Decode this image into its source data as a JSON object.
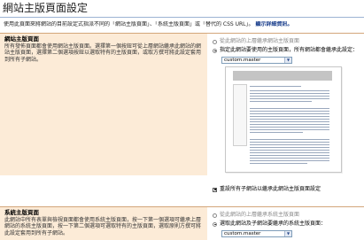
{
  "page": {
    "title": "網站主版頁面設定",
    "description_prefix": "使用此頁面來將網站的目前設定式指派不同的「網站主版頁面」、「系統主版頁面」或「替代的 CSS URL」。",
    "description_link": "顯示詳細資訊。"
  },
  "site_master": {
    "heading": "網站主版頁面",
    "help_text": "所有發佈頁面都會使用網站主版頁面。選擇第一個按鈕可從上層網站繼承此網站的網站主版頁面，選擇第二個選項按鈕以選取特有的主版頁面，或取方撰可將此設定套用到所有子網站。",
    "inherit_option": "從此網站的上層繼承網站主版頁面",
    "specify_option": "指定此網站要使用的主版頁面，所有網站都會繼承此設定：",
    "selected_master": "custom.master",
    "reset_subsites_label": "重設所有子網站以繼承此網站主版頁面設定"
  },
  "system_master": {
    "heading": "系統主版頁面",
    "help_text": "此網站中所有表單與檢視頁面都會使用系統主版頁面，按一下第一個選項可繼承上層網站的系統主版頁面，按一下第二個選項可選取特有的主版頁面，選取原則方撰可將此設定套用到所有子網站。",
    "inherit_option": "從此網站的上層繼承系統主版頁面",
    "specify_option": "選取此網站及子網站要繼承的系統主版頁面：",
    "selected_master": "custom.master"
  }
}
